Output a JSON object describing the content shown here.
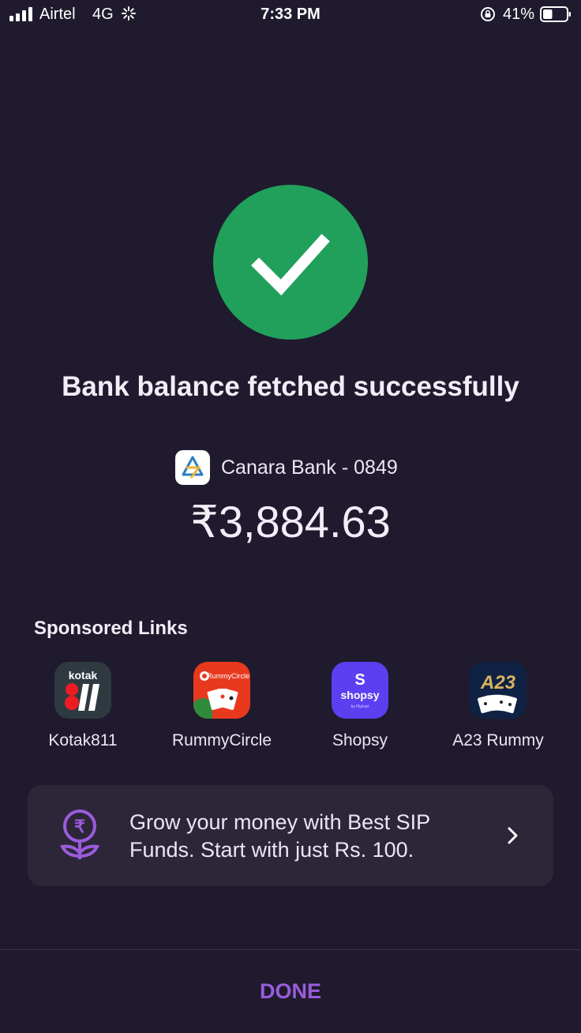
{
  "status_bar": {
    "carrier": "Airtel",
    "network": "4G",
    "time": "7:33 PM",
    "battery": "41%",
    "battery_level": 0.41,
    "icons": [
      "signal-icon",
      "loading-icon",
      "rotation-lock-icon",
      "battery-icon"
    ]
  },
  "result": {
    "icon": "checkmark-icon",
    "headline": "Bank balance fetched successfully",
    "bank_name": "Canara Bank - 0849",
    "balance": "₹3,884.63",
    "success_color": "#21a05b"
  },
  "sponsored": {
    "title": "Sponsored Links",
    "apps": [
      {
        "label": "Kotak811",
        "icon": "kotak811-icon"
      },
      {
        "label": "RummyCircle",
        "icon": "rummycircle-icon"
      },
      {
        "label": "Shopsy",
        "icon": "shopsy-icon"
      },
      {
        "label": "A23 Rummy",
        "icon": "a23-rummy-icon"
      }
    ],
    "icon_text": {
      "kotak": "kotak",
      "rummycircle": "RummyCircle",
      "shopsy_letter": "S",
      "shopsy": "shopsy",
      "shopsy_sub": "by Flipkart",
      "a23": "A23"
    }
  },
  "promo": {
    "icon": "rupee-plant-icon",
    "text": "Grow your money with Best SIP Funds. Start with just Rs. 100.",
    "chevron": "chevron-right-icon"
  },
  "footer": {
    "done_label": "DONE",
    "accent": "#9a5cdc"
  }
}
